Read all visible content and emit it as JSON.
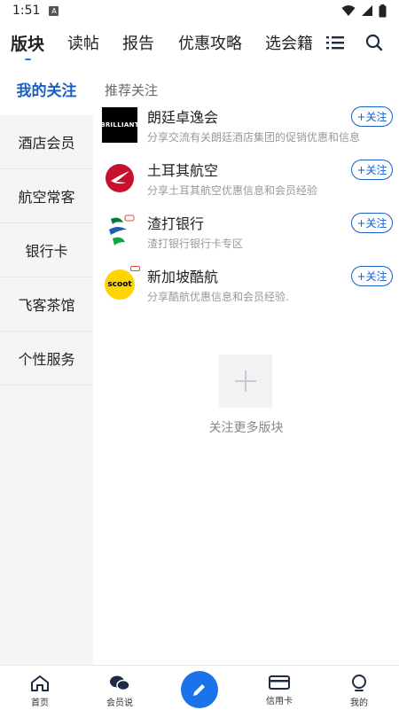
{
  "status": {
    "time": "1:51",
    "notif_letter": "A"
  },
  "tabs": [
    {
      "label": "版块",
      "active": true
    },
    {
      "label": "读帖",
      "active": false
    },
    {
      "label": "报告",
      "active": false
    },
    {
      "label": "优惠攻略",
      "active": false
    },
    {
      "label": "选会籍",
      "active": false
    }
  ],
  "sidebar": {
    "items": [
      {
        "label": "我的关注"
      },
      {
        "label": "酒店会员"
      },
      {
        "label": "航空常客"
      },
      {
        "label": "银行卡"
      },
      {
        "label": "飞客茶馆"
      },
      {
        "label": "个性服务"
      }
    ]
  },
  "main": {
    "section_title": "推荐关注",
    "follow_label": "+关注",
    "forums": [
      {
        "name": "朗廷卓逸会",
        "desc": "分享交流有关朗廷酒店集团的促销优惠和信息",
        "logo_text": "BRILLIANT"
      },
      {
        "name": "土耳其航空",
        "desc": "分享土耳其航空优惠信息和会员经验"
      },
      {
        "name": "渣打银行",
        "desc": "渣打银行银行卡专区"
      },
      {
        "name": "新加坡酷航",
        "desc": "分享酷航优惠信息和会员经验.",
        "logo_text": "scoot"
      }
    ],
    "more_label": "关注更多版块"
  },
  "bottom_nav": [
    {
      "label": "首页",
      "icon": "home-icon"
    },
    {
      "label": "会员说",
      "icon": "chat-icon"
    },
    {
      "label": "",
      "icon": "pen-icon"
    },
    {
      "label": "信用卡",
      "icon": "card-icon"
    },
    {
      "label": "我的",
      "icon": "profile-icon"
    }
  ],
  "colors": {
    "accent": "#1a73e8",
    "active_text": "#1a5fc8",
    "sidebar_bg": "#f4f5f7"
  }
}
